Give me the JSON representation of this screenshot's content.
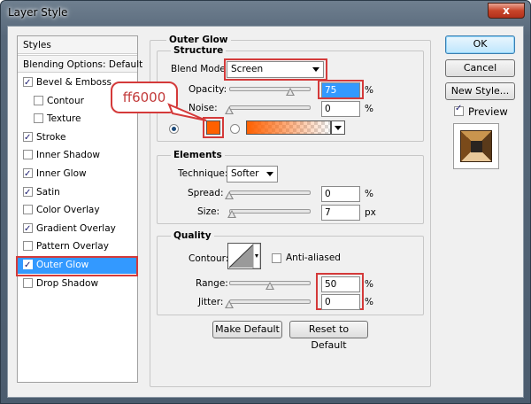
{
  "window": {
    "title": "Layer Style",
    "close_label": "x"
  },
  "styles_panel": {
    "header": "Styles",
    "blending": "Blending Options: Default",
    "items": [
      {
        "label": "Bevel & Emboss",
        "checked": true,
        "indent": false
      },
      {
        "label": "Contour",
        "checked": false,
        "indent": true
      },
      {
        "label": "Texture",
        "checked": false,
        "indent": true
      },
      {
        "label": "Stroke",
        "checked": true,
        "indent": false
      },
      {
        "label": "Inner Shadow",
        "checked": false,
        "indent": false
      },
      {
        "label": "Inner Glow",
        "checked": true,
        "indent": false
      },
      {
        "label": "Satin",
        "checked": true,
        "indent": false
      },
      {
        "label": "Color Overlay",
        "checked": false,
        "indent": false
      },
      {
        "label": "Gradient Overlay",
        "checked": true,
        "indent": false
      },
      {
        "label": "Pattern Overlay",
        "checked": false,
        "indent": false
      },
      {
        "label": "Outer Glow",
        "checked": true,
        "indent": false,
        "selected": true
      },
      {
        "label": "Drop Shadow",
        "checked": false,
        "indent": false
      }
    ]
  },
  "outer_glow": {
    "title": "Outer Glow",
    "structure": {
      "title": "Structure",
      "blend_mode_label": "Blend Mode:",
      "blend_mode_value": "Screen",
      "opacity_label": "Opacity:",
      "opacity_value": "75",
      "opacity_unit": "%",
      "opacity_level": 0.75,
      "noise_label": "Noise:",
      "noise_value": "0",
      "noise_unit": "%",
      "noise_level": 0,
      "color": "#ff6000",
      "callout": "ff6000"
    },
    "elements": {
      "title": "Elements",
      "technique_label": "Technique:",
      "technique_value": "Softer",
      "spread_label": "Spread:",
      "spread_value": "0",
      "spread_unit": "%",
      "spread_level": 0,
      "size_label": "Size:",
      "size_value": "7",
      "size_unit": "px",
      "size_level": 0.03
    },
    "quality": {
      "title": "Quality",
      "contour_label": "Contour:",
      "anti_aliased_label": "Anti-aliased",
      "anti_aliased": false,
      "range_label": "Range:",
      "range_value": "50",
      "range_unit": "%",
      "range_level": 0.5,
      "jitter_label": "Jitter:",
      "jitter_value": "0",
      "jitter_unit": "%",
      "jitter_level": 0
    },
    "make_default": "Make Default",
    "reset_default": "Reset to Default"
  },
  "buttons": {
    "ok": "OK",
    "cancel": "Cancel",
    "new_style": "New Style...",
    "preview_label": "Preview",
    "preview_checked": true
  },
  "colors": {
    "highlight": "#d43a3a",
    "selection": "#3399ff",
    "glow": "#ff6000"
  }
}
